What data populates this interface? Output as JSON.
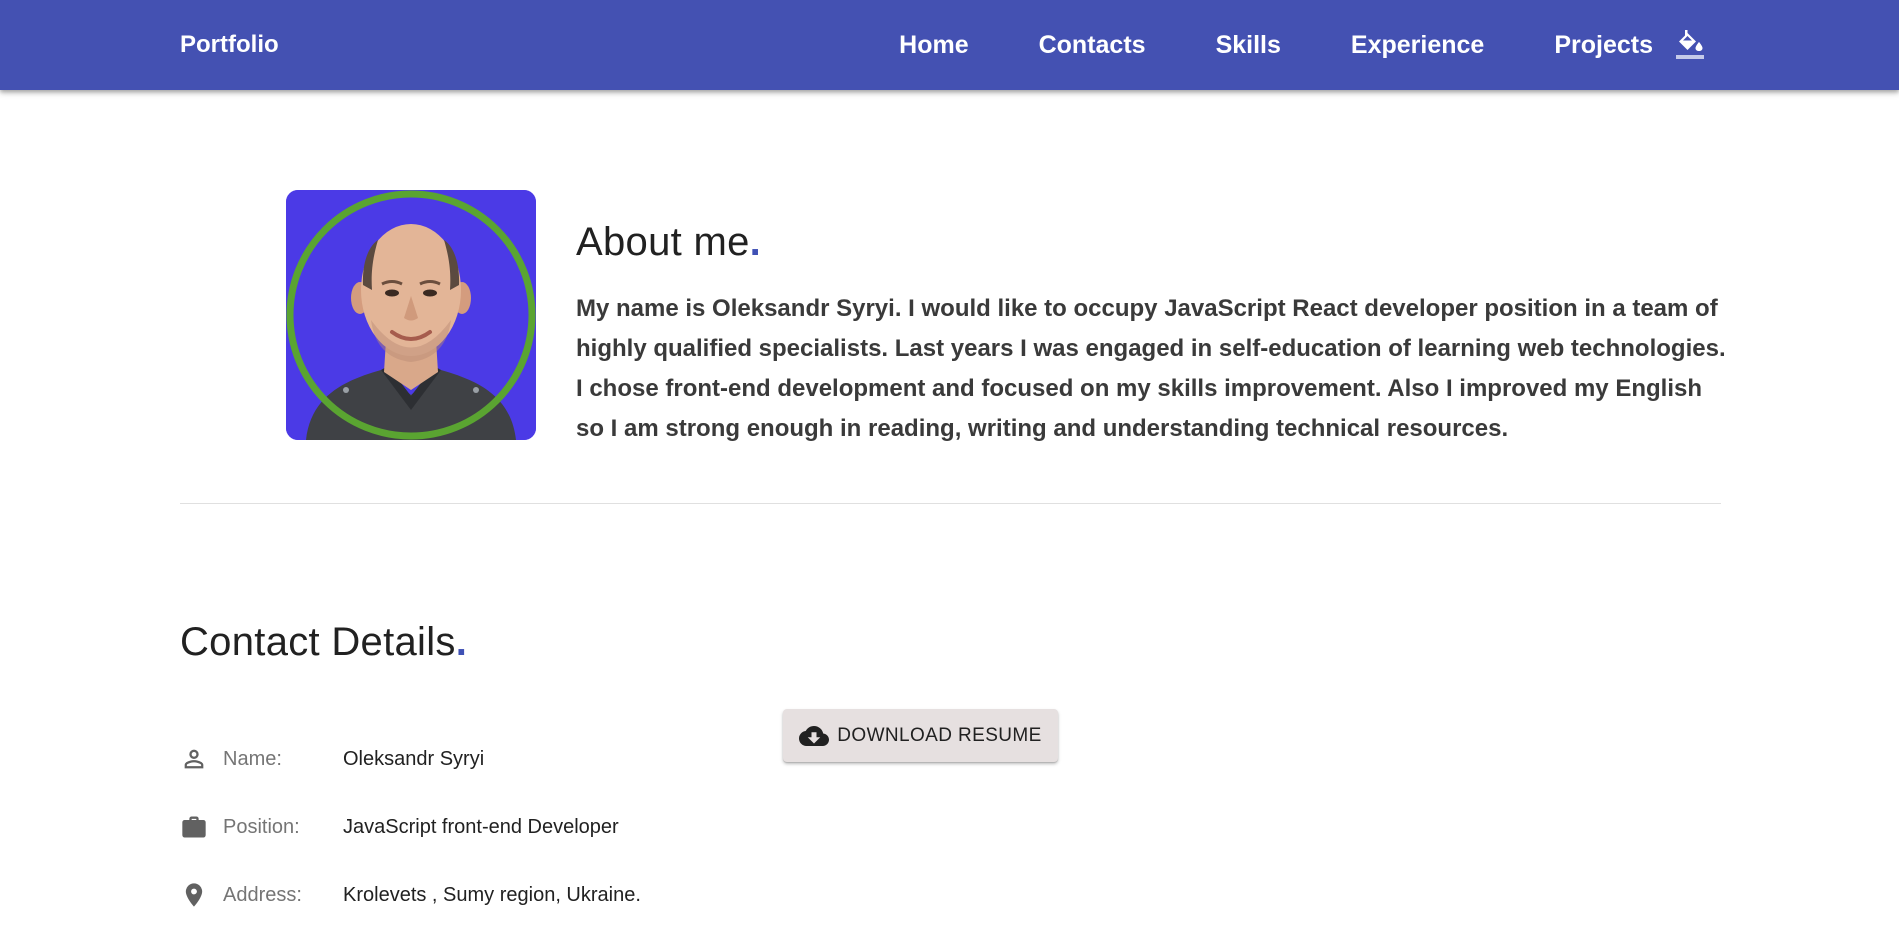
{
  "header": {
    "brand": "Portfolio",
    "nav": [
      "Home",
      "Contacts",
      "Skills",
      "Experience",
      "Projects"
    ],
    "theme_icon": "paint-bucket-icon",
    "background_color": "#4451b2"
  },
  "about": {
    "title": "About me",
    "title_dot": ".",
    "avatar_icon": "profile-photo",
    "body": "My name is Oleksandr Syryi. I would like to occupy JavaScript React developer position in a team of highly qualified specialists. Last years I was engaged in self-education of learning web technologies. I chose front-end development and focused on my skills improvement. Also I improved my English so I am strong enough in reading, writing and understanding technical resources."
  },
  "contact": {
    "title": "Contact Details",
    "title_dot": ".",
    "rows": [
      {
        "icon": "person-icon",
        "label": "Name:",
        "value": "Oleksandr Syryi"
      },
      {
        "icon": "briefcase-icon",
        "label": "Position:",
        "value": "JavaScript front-end Developer"
      },
      {
        "icon": "location-pin-icon",
        "label": "Address:",
        "value": "Krolevets , Sumy region, Ukraine."
      }
    ],
    "download": {
      "icon": "cloud-download-icon",
      "label": "DOWNLOAD RESUME"
    }
  },
  "colors": {
    "accent": "#3f51b5",
    "avatar_bg": "#4b3ae6",
    "avatar_ring": "#5aa431"
  }
}
